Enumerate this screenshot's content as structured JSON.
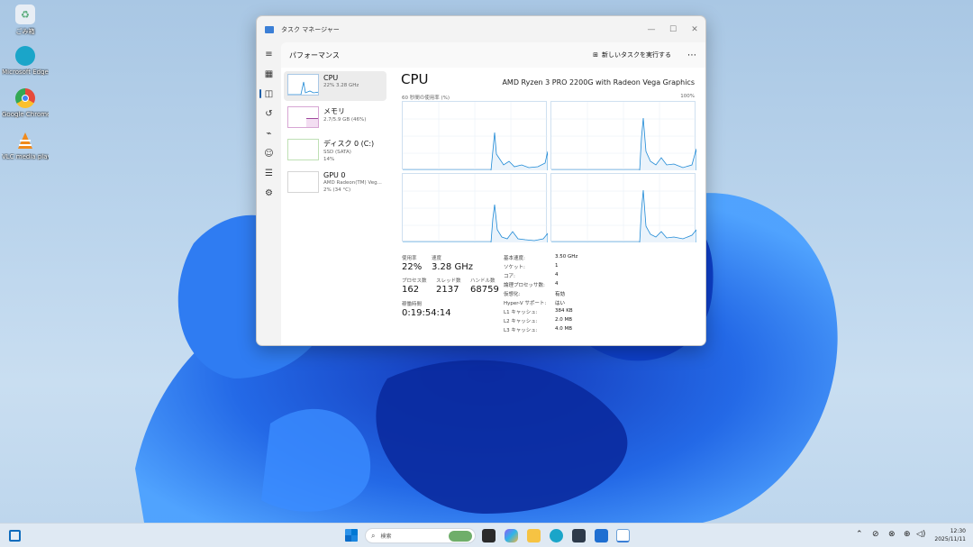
{
  "desktop": {
    "icons": [
      {
        "label": "ごみ箱",
        "icon": "recycle-bin-icon",
        "color": "#e8eef5"
      },
      {
        "label": "Microsoft Edge",
        "icon": "edge-icon",
        "color": "#1aa5c9"
      },
      {
        "label": "Google Chrome",
        "icon": "chrome-icon",
        "color": "#e64a3b"
      },
      {
        "label": "VLC media player",
        "icon": "vlc-icon",
        "color": "#f08a1c"
      }
    ]
  },
  "window": {
    "title": "タスク マネージャー",
    "header": "パフォーマンス",
    "new_task": "新しいタスクを実行する",
    "more": "⋯",
    "controls": {
      "minimize": "—",
      "maximize": "☐",
      "close": "✕"
    }
  },
  "rail": [
    "hamburger-icon",
    "processes-icon",
    "performance-icon",
    "history-icon",
    "startup-icon",
    "users-icon",
    "details-icon",
    "services-icon",
    "settings-icon"
  ],
  "devices": [
    {
      "name": "CPU",
      "sub1": "22%  3.28 GHz",
      "sub2": ""
    },
    {
      "name": "メモリ",
      "sub1": "2.7/5.9 GB (46%)",
      "sub2": ""
    },
    {
      "name": "ディスク 0 (C:)",
      "sub1": "SSD (SATA)",
      "sub2": "14%"
    },
    {
      "name": "GPU 0",
      "sub1": "AMD Radeon(TM) Veg...",
      "sub2": "2% (34 °C)"
    }
  ],
  "main": {
    "title": "CPU",
    "model": "AMD Ryzen 3 PRO 2200G with Radeon Vega Graphics",
    "graph_caption": "60 秒間の使用率 (%)",
    "graph_max": "100%"
  },
  "stats": {
    "usage_label": "使用率",
    "usage": "22%",
    "speed_label": "速度",
    "speed": "3.28 GHz",
    "process_label": "プロセス数",
    "process": "162",
    "thread_label": "スレッド数",
    "thread": "2137",
    "handle_label": "ハンドル数",
    "handle": "68759",
    "uptime_label": "稼働時間",
    "uptime": "0:19:54:14"
  },
  "specs": [
    {
      "k": "基本速度:",
      "v": "3.50 GHz"
    },
    {
      "k": "ソケット:",
      "v": "1"
    },
    {
      "k": "コア:",
      "v": "4"
    },
    {
      "k": "論理プロセッサ数:",
      "v": "4"
    },
    {
      "k": "仮想化:",
      "v": "有効"
    },
    {
      "k": "Hyper-V サポート:",
      "v": "はい"
    },
    {
      "k": "L1 キャッシュ:",
      "v": "384 KB"
    },
    {
      "k": "L2 キャッシュ:",
      "v": "2.0 MB"
    },
    {
      "k": "L3 キャッシュ:",
      "v": "4.0 MB"
    }
  ],
  "taskbar": {
    "search_placeholder": "検索",
    "time": "12:30",
    "date": "2025/11/11"
  }
}
